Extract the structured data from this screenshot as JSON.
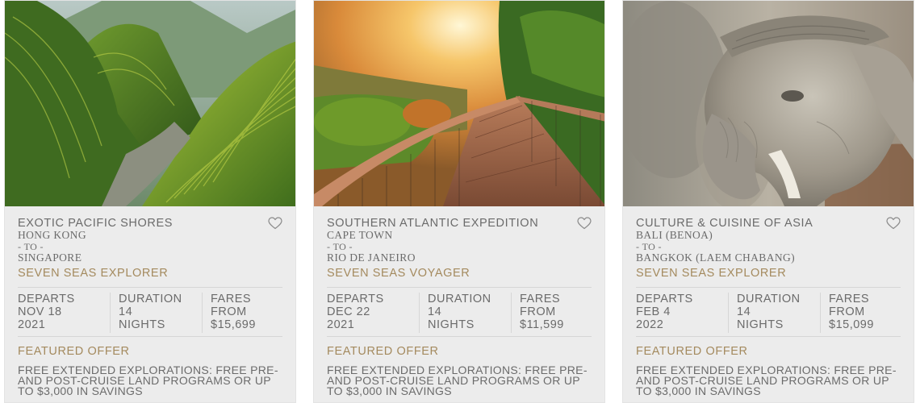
{
  "cards": [
    {
      "title": "EXOTIC PACIFIC SHORES",
      "from_port": "HONG KONG",
      "to_label": "- TO -",
      "to_port": "SINGAPORE",
      "ship": "SEVEN SEAS EXPLORER",
      "departs_label": "DEPARTS",
      "departs_date": "NOV 18",
      "departs_year": "2021",
      "duration_label": "DURATION",
      "duration_value": "14",
      "duration_unit": "NIGHTS",
      "fares_label": "FARES FROM",
      "fares_value": "$15,699",
      "offer_label": "FEATURED OFFER",
      "offer_text": "FREE EXTENDED EXPLORATIONS: FREE PRE- AND POST-CRUISE LAND PROGRAMS OR UP TO $3,000 IN SAVINGS",
      "image": "terraced-rice-fields"
    },
    {
      "title": "SOUTHERN ATLANTIC EXPEDITION",
      "from_port": "CAPE TOWN",
      "to_label": "- TO -",
      "to_port": "RIO DE JANEIRO",
      "ship": "SEVEN SEAS VOYAGER",
      "departs_label": "DEPARTS",
      "departs_date": "DEC 22",
      "departs_year": "2021",
      "duration_label": "DURATION",
      "duration_value": "14",
      "duration_unit": "NIGHTS",
      "fares_label": "FARES FROM",
      "fares_value": "$11,599",
      "offer_label": "FEATURED OFFER",
      "offer_text": "FREE EXTENDED EXPLORATIONS: FREE PRE- AND POST-CRUISE LAND PROGRAMS OR UP TO $3,000 IN SAVINGS",
      "image": "canopy-walkway-sunset"
    },
    {
      "title": "CULTURE & CUISINE OF ASIA",
      "from_port": "BALI (BENOA)",
      "to_label": "- TO -",
      "to_port": "BANGKOK (LAEM CHABANG)",
      "ship": "SEVEN SEAS EXPLORER",
      "departs_label": "DEPARTS",
      "departs_date": "FEB 4",
      "departs_year": "2022",
      "duration_label": "DURATION",
      "duration_value": "14",
      "duration_unit": "NIGHTS",
      "fares_label": "FARES FROM",
      "fares_value": "$15,099",
      "offer_label": "FEATURED OFFER",
      "offer_text": "FREE EXTENDED EXPLORATIONS: FREE PRE- AND POST-CRUISE LAND PROGRAMS OR UP TO $3,000 IN SAVINGS",
      "image": "stone-elephant-statue"
    }
  ],
  "icons": {
    "favorite": "heart-outline-icon"
  },
  "colors": {
    "accent_gold": "#a48a5e",
    "text_gray": "#6b6b6b",
    "card_bg": "#ececec"
  }
}
